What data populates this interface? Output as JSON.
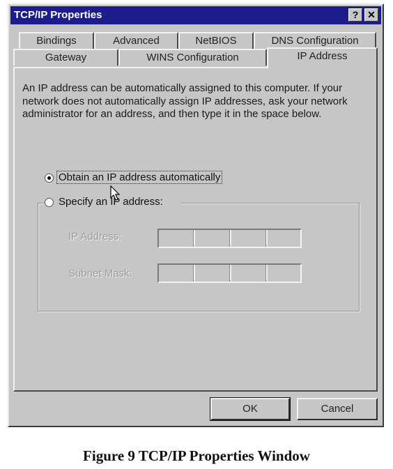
{
  "window": {
    "title": "TCP/IP Properties",
    "help_glyph": "?",
    "close_glyph": "✕"
  },
  "tabs": {
    "row_back": [
      "Bindings",
      "Advanced",
      "NetBIOS",
      "DNS Configuration"
    ],
    "row_front": [
      "Gateway",
      "WINS Configuration",
      "IP Address"
    ],
    "selected": "IP Address"
  },
  "panel": {
    "description": "An IP address can be automatically assigned to this computer. If your network does not automatically assign IP addresses, ask your network administrator for an address, and then type it in the space below.",
    "options": {
      "auto_label": "Obtain an IP address automatically",
      "auto_selected": true,
      "specify_label": "Specify an IP address:",
      "specify_selected": false
    },
    "fields": {
      "ip_label": "IP Address:",
      "ip_value": [
        "",
        "",
        "",
        ""
      ],
      "subnet_label": "Subnet Mask:",
      "subnet_value": [
        "",
        "",
        "",
        ""
      ],
      "enabled": false
    }
  },
  "buttons": {
    "ok": "OK",
    "cancel": "Cancel"
  },
  "caption": "Figure 9 TCP/IP Properties Window",
  "colors": {
    "titlebar": "#1c1c8a",
    "face": "#c6c6c6",
    "disabled_text": "#9e9e9e"
  }
}
